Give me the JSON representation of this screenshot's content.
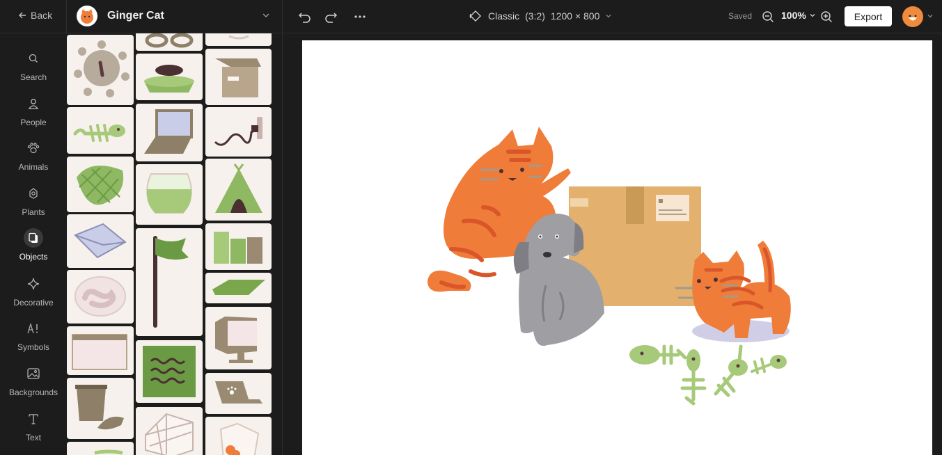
{
  "topbar": {
    "back_label": "Back",
    "project_name": "Ginger Cat",
    "format_label": "Classic",
    "format_ratio": "(3:2)",
    "format_size": "1200 × 800",
    "saved_label": "Saved",
    "zoom_label": "100%",
    "export_label": "Export"
  },
  "rail": {
    "items": [
      {
        "label": "Search",
        "icon": "search-icon"
      },
      {
        "label": "People",
        "icon": "person-icon"
      },
      {
        "label": "Animals",
        "icon": "paw-icon"
      },
      {
        "label": "Plants",
        "icon": "flower-icon"
      },
      {
        "label": "Objects",
        "icon": "objects-icon",
        "active": true
      },
      {
        "label": "Decorative",
        "icon": "sparkle-icon"
      },
      {
        "label": "Symbols",
        "icon": "symbols-icon"
      },
      {
        "label": "Backgrounds",
        "icon": "image-icon"
      },
      {
        "label": "Text",
        "icon": "text-icon"
      }
    ]
  },
  "assets": {
    "items": [
      "glasses-asset",
      "coffee-cup-asset",
      "virus-asset",
      "pet-bowl-asset",
      "cardboard-box-asset",
      "fish-bone-asset",
      "laptop-asset",
      "plug-asset",
      "pinecone-asset",
      "fishbowl-asset",
      "tent-asset",
      "envelope-asset",
      "flag-asset",
      "books-asset",
      "mat-asset",
      "worm-asset",
      "monitor-asset",
      "browser-window-asset",
      "notepad-asset",
      "laptop-paw-asset",
      "trash-can-asset",
      "cage-asset",
      "jar-asset"
    ]
  },
  "colors": {
    "accent_orange": "#f07c3a",
    "box_tan": "#e3b06d",
    "dog_gray": "#9e9ea3",
    "leaf_green": "#a7c97a",
    "panel_dark": "#1c1c1c"
  }
}
